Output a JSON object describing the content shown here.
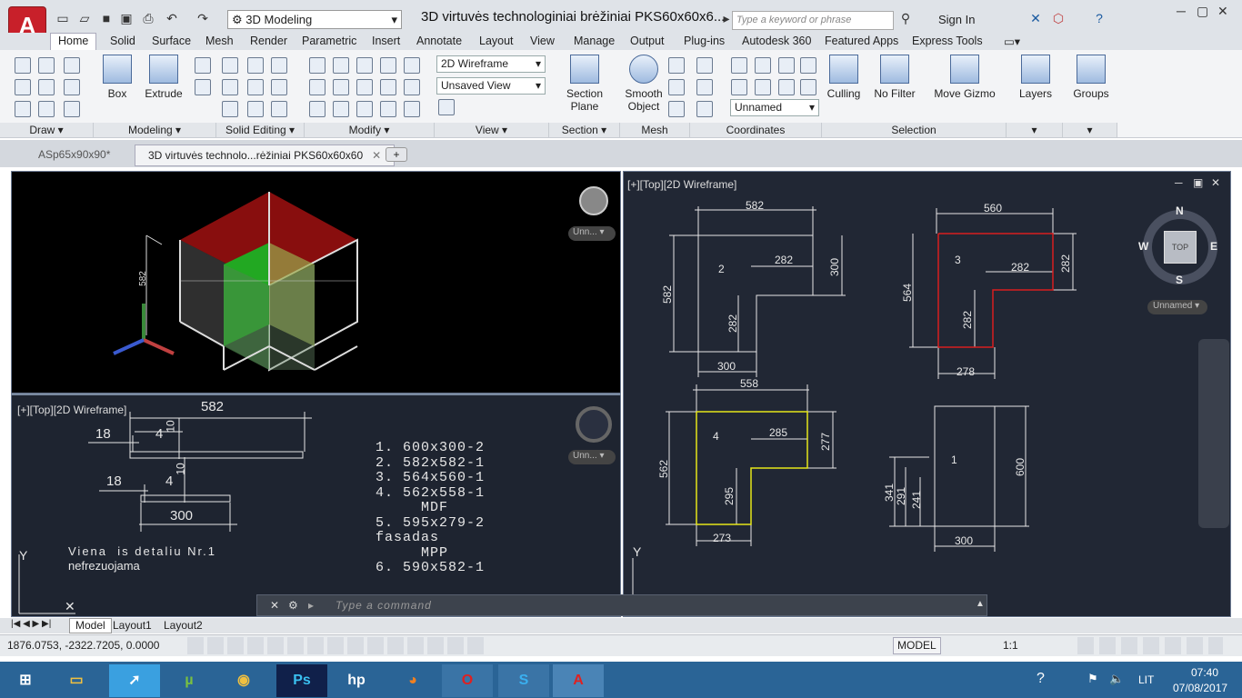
{
  "title": {
    "text": "3D virtuvės technologiniai brėžiniai PKS60x60x6...",
    "workspace": "3D Modeling",
    "search_placeholder": "Type a keyword or phrase",
    "sign_in": "Sign In"
  },
  "menu": [
    "Home",
    "Solid",
    "Surface",
    "Mesh",
    "Render",
    "Parametric",
    "Insert",
    "Annotate",
    "Layout",
    "View",
    "Manage",
    "Output",
    "Plug-ins",
    "Autodesk 360",
    "Featured Apps",
    "Express Tools"
  ],
  "ribbon": {
    "box": "Box",
    "extrude": "Extrude",
    "section_plane": "Section",
    "section_plane2": "Plane",
    "smooth": "Smooth",
    "smooth2": "Object",
    "culling": "Culling",
    "no_filter": "No Filter",
    "move_gizmo": "Move Gizmo",
    "layers": "Layers",
    "groups": "Groups",
    "visual_style": "2D Wireframe",
    "view": "Unsaved View",
    "ucs": "Unnamed",
    "panels": {
      "draw": "Draw",
      "modeling": "Modeling",
      "solid_editing": "Solid Editing",
      "modify": "Modify",
      "view": "View",
      "section": "Section",
      "mesh": "Mesh",
      "coordinates": "Coordinates",
      "selection": "Selection"
    }
  },
  "doctabs": {
    "tab1": "ASp65x90x90*",
    "tab2": "3D virtuvės technolo...rėžiniai PKS60x60x60"
  },
  "viewports": {
    "tl_dropdown": "Unn...",
    "bl": {
      "label": "[+][Top][2D Wireframe]",
      "d582": "582",
      "d18a": "18",
      "d4a": "4",
      "d10a": "10",
      "d18b": "18",
      "d4b": "4",
      "d10b": "10",
      "d300": "300",
      "list": [
        "1.  600x300-2",
        "2.  582x582-1",
        "3.  564x560-1",
        "4.  562x558-1",
        "     MDF",
        "5.  595x279-2",
        "fasadas",
        "     MPP",
        "6.  590x582-1"
      ],
      "note1": "Viena  is detaliu Nr.1",
      "note2": "nefrezuojama",
      "dropdown": "Unn..."
    },
    "tl_dim": "582",
    "r": {
      "label": "[+][Top][2D Wireframe]",
      "p2": {
        "n": "2",
        "w": "582",
        "a": "282",
        "b": "300",
        "h": "582",
        "c": "282",
        "d": "300"
      },
      "p3": {
        "n": "3",
        "w": "560",
        "a": "282",
        "b": "282",
        "h": "564",
        "c": "282",
        "d": "278"
      },
      "p4": {
        "n": "4",
        "w": "558",
        "a": "285",
        "b": "277",
        "h": "562",
        "c": "295",
        "d": "273"
      },
      "p1": {
        "n": "1",
        "h": "600",
        "a": "341",
        "b": "291",
        "c": "241",
        "d": "300"
      },
      "compass": {
        "n": "N",
        "s": "S",
        "e": "E",
        "w": "W",
        "top": "TOP"
      },
      "ucs": "Unnamed"
    }
  },
  "command": {
    "placeholder": "Type a command"
  },
  "layouts": [
    "Model",
    "Layout1",
    "Layout2"
  ],
  "status": {
    "coords": "1876.0753, -2322.7205, 0.0000",
    "model": "MODEL",
    "scale": "1:1"
  },
  "taskbar": {
    "time": "07:40",
    "date": "07/08/2017",
    "lang": "LIT"
  },
  "colors": {
    "red": "#d81e1e",
    "yellow": "#e5e51a",
    "panel": "#212734",
    "accent": "#c8202a"
  }
}
